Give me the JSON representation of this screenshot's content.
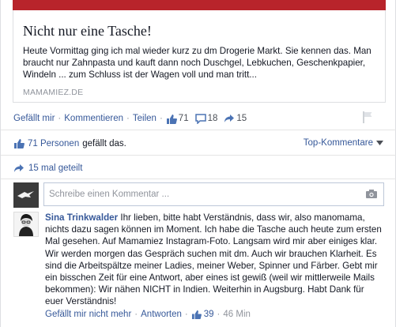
{
  "link": {
    "title": "Nicht nur eine Tasche!",
    "description": "Heute Vormittag ging ich mal wieder kurz zu dm Drogerie Markt. Sie kennen das. Man braucht nur Zahnpasta und kauft dann noch Duschgel, Lebkuchen, Geschenkpapier, Windeln ... zum Schluss ist der Wagen voll und man tritt...",
    "domain": "MAMAMIEZ.DE"
  },
  "actions": {
    "like": "Gefällt mir",
    "comment": "Kommentieren",
    "share": "Teilen",
    "like_count": "71",
    "comment_count": "18",
    "share_count": "15"
  },
  "likes_summary": {
    "count_label": "71 Personen",
    "suffix": "gefällt das."
  },
  "top_comments": "Top-Kommentare",
  "shares_summary": "15 mal geteilt",
  "comment_input": {
    "placeholder": "Schreibe einen Kommentar ..."
  },
  "comment": {
    "author": "Sina Trinkwalder",
    "text": "Ihr lieben, bitte habt Verständnis, dass wir, also manomama, nichts dazu sagen können im Moment. Ich habe die Tasche auch heute zum ersten Mal gesehen. Auf Mamamiez Instagram-Foto. Langsam wird mir aber einiges klar. Wir werden morgen das Gespräch suchen mit dm. Auch wir brauchen Klarheit. Es sind die Arbeitspältze meiner Ladies, meiner Weber, Spinner und Färber. Gebt mir ein bisschen Zeit für eine Antwort, aber eines ist gewiß (weil wir mittlerweile Mails bekommen): Wir nähen NICHT in Indien. Weiterhin in Augsburg. Habt Dank für euer Verständnis!",
    "unlike": "Gefällt mir nicht mehr",
    "reply": "Antworten",
    "likes": "39",
    "time": "46 Min"
  },
  "colors": {
    "link_blue": "#365899",
    "muted": "#90949c",
    "cover_red": "#b8242b"
  },
  "icons": [
    "thumbs-up-icon",
    "comment-icon",
    "share-icon",
    "flag-icon",
    "camera-icon",
    "chevron-down-icon"
  ]
}
